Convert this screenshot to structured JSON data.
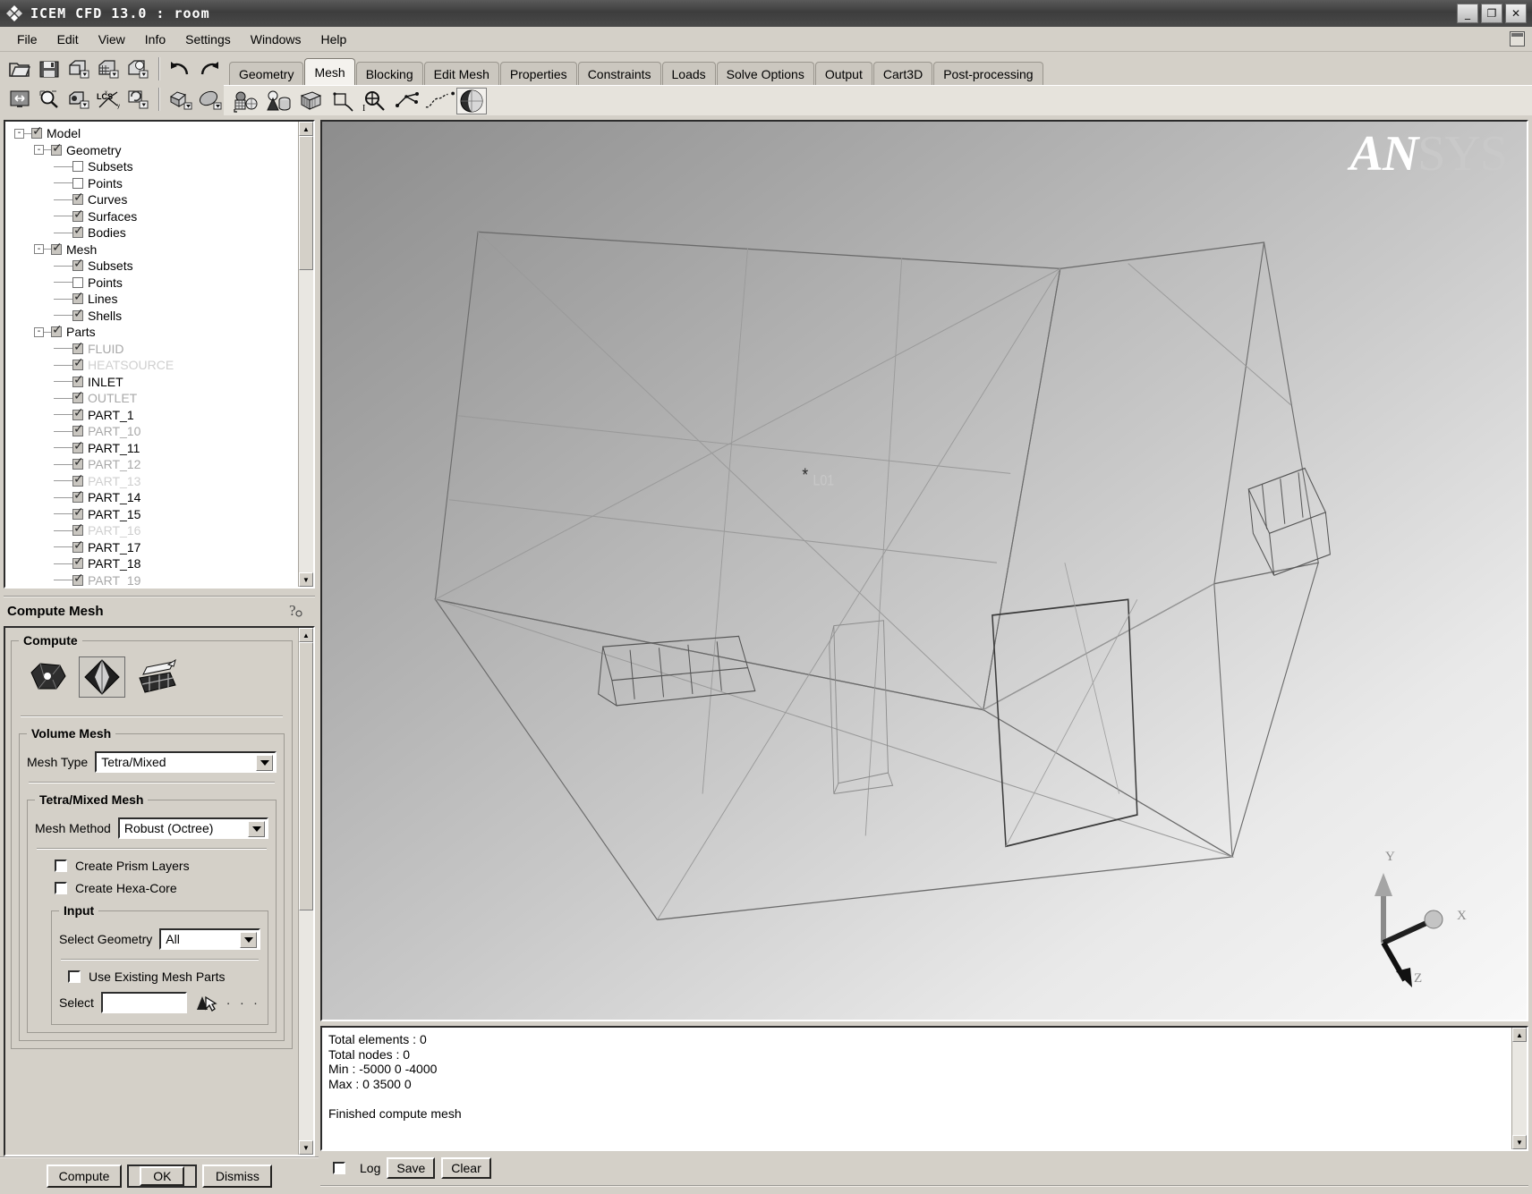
{
  "window": {
    "title": "ICEM CFD 13.0 : room",
    "app_icon": "ansys-diamond-icon",
    "minimize_label": "_",
    "maximize_label": "❐",
    "close_label": "✕"
  },
  "menubar": {
    "items": [
      {
        "label": "File",
        "name": "menu-file"
      },
      {
        "label": "Edit",
        "name": "menu-edit"
      },
      {
        "label": "View",
        "name": "menu-view"
      },
      {
        "label": "Info",
        "name": "menu-info"
      },
      {
        "label": "Settings",
        "name": "menu-settings"
      },
      {
        "label": "Windows",
        "name": "menu-windows"
      },
      {
        "label": "Help",
        "name": "menu-help"
      }
    ],
    "dock_icon": "undock-icon"
  },
  "toolbar": {
    "row1": [
      "open-folder-icon",
      "save-disk-icon",
      "save-geometry-icon",
      "save-mesh-icon",
      "save-blocking-icon"
    ],
    "row2": [
      "fit-window-icon",
      "zoom-box-icon",
      "camera-icon",
      "lcs-axes-icon",
      "refresh-icon"
    ],
    "undo_icon": "undo-arrow-icon",
    "redo_icon": "redo-arrow-icon",
    "view_icons": [
      "isometric-view-icon",
      "solid-view-icon"
    ]
  },
  "tabs": {
    "items": [
      {
        "label": "Geometry",
        "active": false
      },
      {
        "label": "Mesh",
        "active": true
      },
      {
        "label": "Blocking",
        "active": false
      },
      {
        "label": "Edit Mesh",
        "active": false
      },
      {
        "label": "Properties",
        "active": false
      },
      {
        "label": "Constraints",
        "active": false
      },
      {
        "label": "Loads",
        "active": false
      },
      {
        "label": "Solve Options",
        "active": false
      },
      {
        "label": "Output",
        "active": false
      },
      {
        "label": "Cart3D",
        "active": false
      },
      {
        "label": "Post-processing",
        "active": false
      }
    ],
    "mesh_tools": [
      "global-mesh-setup-icon",
      "part-mesh-setup-icon",
      "surface-mesh-setup-icon",
      "curve-mesh-setup-icon",
      "density-mesh-icon",
      "create-mesh-density-icon",
      "edit-mesh-curve-icon",
      "compute-mesh-icon"
    ]
  },
  "tree": {
    "nodes": [
      {
        "label": "Model",
        "depth": 0,
        "expander": "-",
        "check": "on",
        "dim": 0
      },
      {
        "label": "Geometry",
        "depth": 1,
        "expander": "-",
        "check": "on",
        "dim": 0
      },
      {
        "label": "Subsets",
        "depth": 2,
        "expander": "",
        "check": "off",
        "dim": 0
      },
      {
        "label": "Points",
        "depth": 2,
        "expander": "",
        "check": "off",
        "dim": 0
      },
      {
        "label": "Curves",
        "depth": 2,
        "expander": "",
        "check": "on",
        "dim": 0
      },
      {
        "label": "Surfaces",
        "depth": 2,
        "expander": "",
        "check": "on",
        "dim": 0
      },
      {
        "label": "Bodies",
        "depth": 2,
        "expander": "",
        "check": "on",
        "dim": 0
      },
      {
        "label": "Mesh",
        "depth": 1,
        "expander": "-",
        "check": "on",
        "dim": 0
      },
      {
        "label": "Subsets",
        "depth": 2,
        "expander": "",
        "check": "on",
        "dim": 0
      },
      {
        "label": "Points",
        "depth": 2,
        "expander": "",
        "check": "off",
        "dim": 0
      },
      {
        "label": "Lines",
        "depth": 2,
        "expander": "",
        "check": "on",
        "dim": 0
      },
      {
        "label": "Shells",
        "depth": 2,
        "expander": "",
        "check": "on",
        "dim": 0
      },
      {
        "label": "Parts",
        "depth": 1,
        "expander": "-",
        "check": "on",
        "dim": 0
      },
      {
        "label": "FLUID",
        "depth": 2,
        "expander": "",
        "check": "on",
        "dim": 2
      },
      {
        "label": "HEATSOURCE",
        "depth": 2,
        "expander": "",
        "check": "on",
        "dim": 3
      },
      {
        "label": "INLET",
        "depth": 2,
        "expander": "",
        "check": "on",
        "dim": 0
      },
      {
        "label": "OUTLET",
        "depth": 2,
        "expander": "",
        "check": "on",
        "dim": 2
      },
      {
        "label": "PART_1",
        "depth": 2,
        "expander": "",
        "check": "on",
        "dim": 0
      },
      {
        "label": "PART_10",
        "depth": 2,
        "expander": "",
        "check": "on",
        "dim": 2
      },
      {
        "label": "PART_11",
        "depth": 2,
        "expander": "",
        "check": "on",
        "dim": 0
      },
      {
        "label": "PART_12",
        "depth": 2,
        "expander": "",
        "check": "on",
        "dim": 2
      },
      {
        "label": "PART_13",
        "depth": 2,
        "expander": "",
        "check": "on",
        "dim": 3
      },
      {
        "label": "PART_14",
        "depth": 2,
        "expander": "",
        "check": "on",
        "dim": 0
      },
      {
        "label": "PART_15",
        "depth": 2,
        "expander": "",
        "check": "on",
        "dim": 0
      },
      {
        "label": "PART_16",
        "depth": 2,
        "expander": "",
        "check": "on",
        "dim": 3
      },
      {
        "label": "PART_17",
        "depth": 2,
        "expander": "",
        "check": "on",
        "dim": 0
      },
      {
        "label": "PART_18",
        "depth": 2,
        "expander": "",
        "check": "on",
        "dim": 0
      },
      {
        "label": "PART_19",
        "depth": 2,
        "expander": "",
        "check": "on",
        "dim": 2
      }
    ]
  },
  "panel": {
    "title": "Compute Mesh",
    "help_icon": "help-question-icon",
    "compute_group_label": "Compute",
    "compute_icons": [
      {
        "name": "compute-volume-mesh-icon",
        "selected": false
      },
      {
        "name": "compute-tetra-mesh-icon",
        "selected": true
      },
      {
        "name": "compute-prism-mesh-icon",
        "selected": false
      }
    ],
    "volume_mesh": {
      "group_label": "Volume Mesh",
      "mesh_type_label": "Mesh Type",
      "mesh_type_value": "Tetra/Mixed",
      "tetra_group_label": "Tetra/Mixed Mesh",
      "mesh_method_label": "Mesh Method",
      "mesh_method_value": "Robust (Octree)",
      "create_prism_label": "Create Prism Layers",
      "create_prism_checked": false,
      "create_hexacore_label": "Create Hexa-Core",
      "create_hexacore_checked": false,
      "input_group_label": "Input",
      "select_geometry_label": "Select Geometry",
      "select_geometry_value": "All",
      "use_existing_label": "Use Existing Mesh Parts",
      "use_existing_checked": false,
      "select_label": "Select",
      "select_value": "",
      "select_arrow_icon": "select-cursor-icon",
      "select_dots": "· · ·"
    },
    "buttons": [
      {
        "label": "Compute",
        "default": false,
        "name": "compute-button"
      },
      {
        "label": "OK",
        "default": true,
        "name": "ok-button"
      },
      {
        "label": "Dismiss",
        "default": false,
        "name": "dismiss-button"
      }
    ]
  },
  "viewport": {
    "logo_an": "AN",
    "logo_sys": "SYS",
    "axis_x": "X",
    "axis_y": "Y",
    "axis_z": "Z",
    "annotation": "*"
  },
  "messages": {
    "text": "Total elements : 0\nTotal nodes : 0\nMin : -5000 0 -4000\nMax : 0 3500 0\n\nFinished compute mesh",
    "lines": [
      "Total elements : 0",
      "Total nodes : 0",
      "Min : -5000 0 -4000",
      "Max : 0 3500 0",
      "",
      "Finished compute mesh"
    ],
    "log_label": "Log",
    "log_checked": false,
    "save_label": "Save",
    "clear_label": "Clear"
  }
}
